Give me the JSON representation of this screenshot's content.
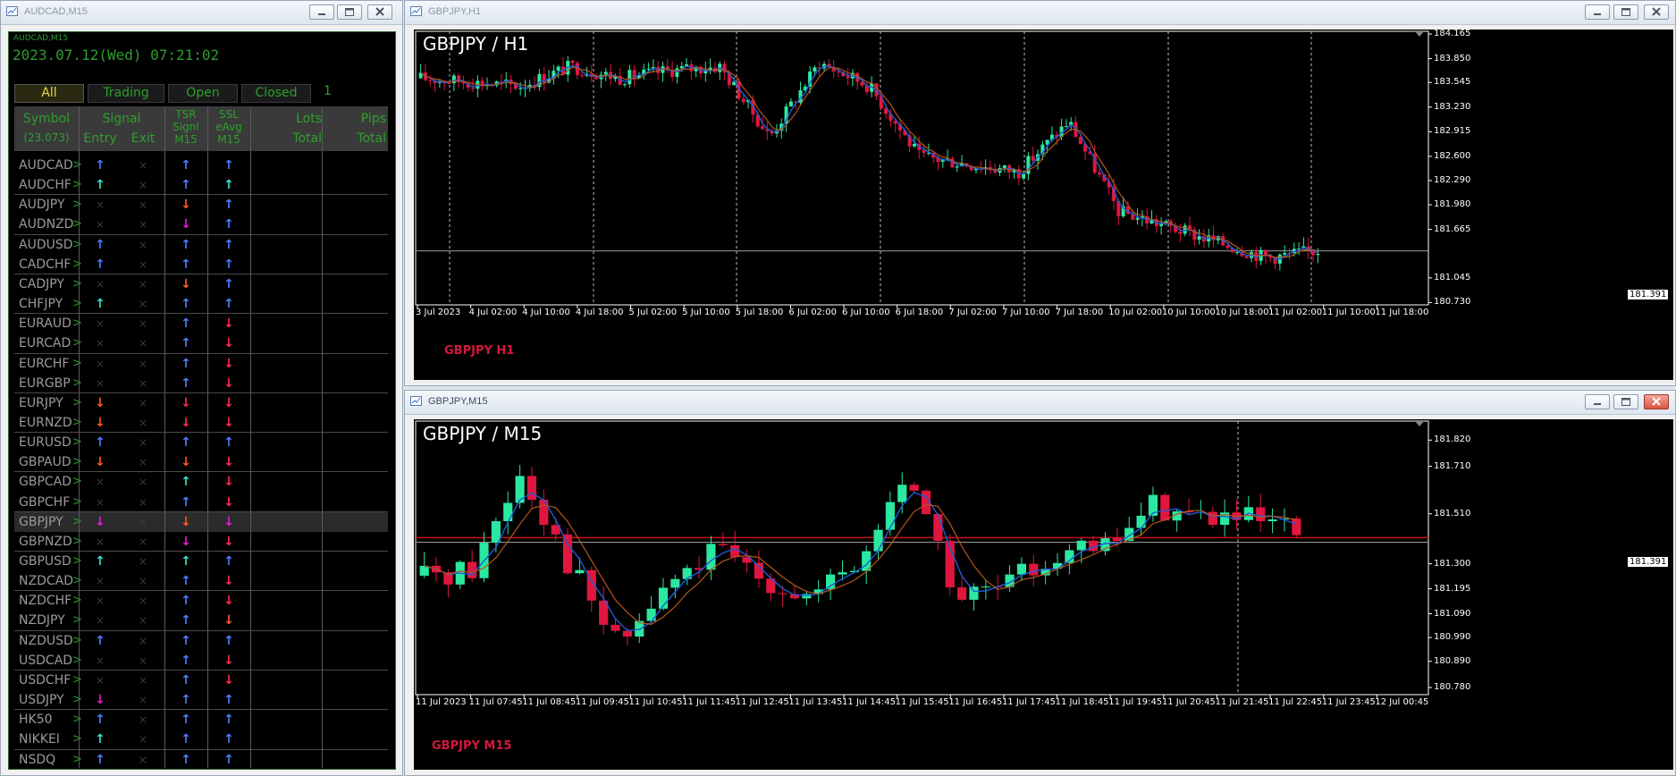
{
  "windows": {
    "dashboard_title": "AUDCAD,M15",
    "h1_title": "GBPJPY,H1",
    "m15_title": "GBPJPY,M15"
  },
  "dashboard": {
    "small_label": "AUDCAD,M15",
    "datetime": "2023.07.12(Wed) 07:21:02",
    "tabs": [
      "All",
      "Trading",
      "Open",
      "Closed"
    ],
    "count": "1",
    "headers": {
      "symbol": "Symbol",
      "symbol_sub": "(23.073)",
      "signal": "Signal",
      "entry": "Entry",
      "exit": "Exit",
      "tsr1": "TSR",
      "tsr2": "Signl",
      "tsr3": "M15",
      "ssl1": "SSL",
      "ssl2": "eAvg",
      "ssl3": "M15",
      "lots1": "Lots",
      "lots2": "Total",
      "pips1": "Pips",
      "pips2": "Total"
    },
    "colors": {
      "up_blue": "#4f7bff",
      "up_cyan": "#36e0d0",
      "down_orange": "#ff5a1a",
      "down_red": "#ff2a4a",
      "down_magenta": "#e21bd6"
    },
    "rows": [
      {
        "symbol": "AUDCAD",
        "entry": "up_blue",
        "exit": "x",
        "tsr": "up_blue",
        "ssl": "up_blue"
      },
      {
        "symbol": "AUDCHF",
        "entry": "up_cyan",
        "exit": "x",
        "tsr": "up_blue",
        "ssl": "up_cyan"
      },
      {
        "symbol": "AUDJPY",
        "entry": "x",
        "exit": "x",
        "tsr": "down_orange",
        "ssl": "up_blue"
      },
      {
        "symbol": "AUDNZD",
        "entry": "x",
        "exit": "x",
        "tsr": "down_magenta",
        "ssl": "up_blue"
      },
      {
        "symbol": "AUDUSD",
        "entry": "up_blue",
        "exit": "x",
        "tsr": "up_blue",
        "ssl": "up_blue"
      },
      {
        "symbol": "CADCHF",
        "entry": "up_blue",
        "exit": "x",
        "tsr": "up_blue",
        "ssl": "up_blue"
      },
      {
        "symbol": "CADJPY",
        "entry": "x",
        "exit": "x",
        "tsr": "down_orange",
        "ssl": "up_blue"
      },
      {
        "symbol": "CHFJPY",
        "entry": "up_cyan",
        "exit": "x",
        "tsr": "up_blue",
        "ssl": "up_blue"
      },
      {
        "symbol": "EURAUD",
        "entry": "x",
        "exit": "x",
        "tsr": "up_blue",
        "ssl": "down_red"
      },
      {
        "symbol": "EURCAD",
        "entry": "x",
        "exit": "x",
        "tsr": "up_blue",
        "ssl": "down_red"
      },
      {
        "symbol": "EURCHF",
        "entry": "x",
        "exit": "x",
        "tsr": "up_blue",
        "ssl": "down_red"
      },
      {
        "symbol": "EURGBP",
        "entry": "x",
        "exit": "x",
        "tsr": "up_blue",
        "ssl": "down_red"
      },
      {
        "symbol": "EURJPY",
        "entry": "down_orange",
        "exit": "x",
        "tsr": "down_red",
        "ssl": "down_red"
      },
      {
        "symbol": "EURNZD",
        "entry": "down_orange",
        "exit": "x",
        "tsr": "down_red",
        "ssl": "down_red"
      },
      {
        "symbol": "EURUSD",
        "entry": "up_blue",
        "exit": "x",
        "tsr": "up_blue",
        "ssl": "up_blue"
      },
      {
        "symbol": "GBPAUD",
        "entry": "down_orange",
        "exit": "x",
        "tsr": "down_orange",
        "ssl": "down_red"
      },
      {
        "symbol": "GBPCAD",
        "entry": "x",
        "exit": "x",
        "tsr": "up_cyan",
        "ssl": "down_red"
      },
      {
        "symbol": "GBPCHF",
        "entry": "x",
        "exit": "x",
        "tsr": "up_blue",
        "ssl": "down_red"
      },
      {
        "symbol": "GBPJPY",
        "entry": "down_magenta",
        "exit": "x",
        "tsr": "down_orange",
        "ssl": "down_magenta",
        "selected": true
      },
      {
        "symbol": "GBPNZD",
        "entry": "x",
        "exit": "x",
        "tsr": "down_magenta",
        "ssl": "down_red"
      },
      {
        "symbol": "GBPUSD",
        "entry": "up_cyan",
        "exit": "x",
        "tsr": "up_cyan",
        "ssl": "up_blue"
      },
      {
        "symbol": "NZDCAD",
        "entry": "x",
        "exit": "x",
        "tsr": "up_blue",
        "ssl": "down_red"
      },
      {
        "symbol": "NZDCHF",
        "entry": "x",
        "exit": "x",
        "tsr": "up_blue",
        "ssl": "down_red"
      },
      {
        "symbol": "NZDJPY",
        "entry": "x",
        "exit": "x",
        "tsr": "up_blue",
        "ssl": "down_orange"
      },
      {
        "symbol": "NZDUSD",
        "entry": "up_blue",
        "exit": "x",
        "tsr": "up_blue",
        "ssl": "up_blue"
      },
      {
        "symbol": "USDCAD",
        "entry": "x",
        "exit": "x",
        "tsr": "up_blue",
        "ssl": "down_red"
      },
      {
        "symbol": "USDCHF",
        "entry": "x",
        "exit": "x",
        "tsr": "up_blue",
        "ssl": "down_red"
      },
      {
        "symbol": "USDJPY",
        "entry": "down_magenta",
        "exit": "x",
        "tsr": "up_blue",
        "ssl": "up_blue"
      },
      {
        "symbol": "HK50",
        "entry": "up_blue",
        "exit": "x",
        "tsr": "up_blue",
        "ssl": "up_blue"
      },
      {
        "symbol": "NIKKEI",
        "entry": "up_cyan",
        "exit": "x",
        "tsr": "up_blue",
        "ssl": "up_blue"
      },
      {
        "symbol": "NSDQ",
        "entry": "up_blue",
        "exit": "x",
        "tsr": "up_blue",
        "ssl": "up_blue"
      }
    ]
  },
  "chart_h1": {
    "title": "GBPJPY / H1",
    "sub_label": "GBPJPY H1",
    "price_levels": [
      "184.165",
      "183.850",
      "183.545",
      "183.230",
      "182.915",
      "182.600",
      "182.290",
      "181.980",
      "181.665",
      "181.045",
      "180.730"
    ],
    "current_price": "181.391",
    "time_labels": [
      "3 Jul 2023",
      "4 Jul 02:00",
      "4 Jul 10:00",
      "4 Jul 18:00",
      "5 Jul 02:00",
      "5 Jul 10:00",
      "5 Jul 18:00",
      "6 Jul 02:00",
      "6 Jul 10:00",
      "6 Jul 18:00",
      "7 Jul 02:00",
      "7 Jul 10:00",
      "7 Jul 18:00",
      "10 Jul 02:00",
      "10 Jul 10:00",
      "10 Jul 18:00",
      "11 Jul 02:00",
      "11 Jul 10:00",
      "11 Jul 18:00"
    ]
  },
  "chart_m15": {
    "title": "GBPJPY / M15",
    "sub_label": "GBPJPY M15",
    "price_levels": [
      "181.820",
      "181.710",
      "181.510",
      "181.300",
      "181.195",
      "181.090",
      "180.990",
      "180.890",
      "180.780"
    ],
    "current_price": "181.391",
    "time_labels": [
      "11 Jul 2023",
      "11 Jul 07:45",
      "11 Jul 08:45",
      "11 Jul 09:45",
      "11 Jul 10:45",
      "11 Jul 11:45",
      "11 Jul 12:45",
      "11 Jul 13:45",
      "11 Jul 14:45",
      "11 Jul 15:45",
      "11 Jul 16:45",
      "11 Jul 17:45",
      "11 Jul 18:45",
      "11 Jul 19:45",
      "11 Jul 20:45",
      "11 Jul 21:45",
      "11 Jul 22:45",
      "11 Jul 23:45",
      "12 Jul 00:45"
    ]
  },
  "chart_data": [
    {
      "type": "line",
      "title": "GBPJPY / H1",
      "xlabel": "",
      "ylabel": "",
      "x": [
        "3 Jul 2023",
        "4 Jul 02:00",
        "4 Jul 10:00",
        "4 Jul 18:00",
        "5 Jul 02:00",
        "5 Jul 10:00",
        "5 Jul 18:00",
        "6 Jul 02:00",
        "6 Jul 10:00",
        "6 Jul 18:00",
        "7 Jul 02:00",
        "7 Jul 10:00",
        "7 Jul 18:00",
        "10 Jul 02:00",
        "10 Jul 10:00",
        "10 Jul 18:00",
        "11 Jul 02:00",
        "11 Jul 10:00",
        "11 Jul 18:00"
      ],
      "series": [
        {
          "values": [
            183.6,
            183.55,
            183.5,
            183.75,
            183.6,
            183.7,
            183.75,
            182.85,
            183.8,
            183.5,
            182.6,
            182.5,
            182.4,
            183.05,
            181.9,
            181.7,
            181.5,
            181.3,
            181.4
          ]
        }
      ],
      "ylim": [
        180.7,
        184.2
      ]
    },
    {
      "type": "line",
      "title": "GBPJPY / M15",
      "xlabel": "",
      "ylabel": "",
      "x": [
        "11 Jul 2023",
        "11 Jul 07:45",
        "11 Jul 08:45",
        "11 Jul 09:45",
        "11 Jul 10:45",
        "11 Jul 11:45",
        "11 Jul 12:45",
        "11 Jul 13:45",
        "11 Jul 14:45",
        "11 Jul 15:45",
        "11 Jul 16:45",
        "11 Jul 17:45",
        "11 Jul 18:45",
        "11 Jul 19:45",
        "11 Jul 20:45",
        "11 Jul 21:45",
        "11 Jul 22:45",
        "11 Jul 23:45",
        "12 Jul 00:45"
      ],
      "series": [
        {
          "values": [
            181.25,
            181.28,
            181.7,
            181.3,
            180.95,
            181.2,
            181.35,
            181.25,
            181.15,
            181.3,
            181.7,
            181.15,
            181.2,
            181.35,
            181.35,
            181.55,
            181.5,
            181.48,
            181.42
          ]
        }
      ],
      "ylim": [
        180.75,
        181.9
      ]
    }
  ]
}
